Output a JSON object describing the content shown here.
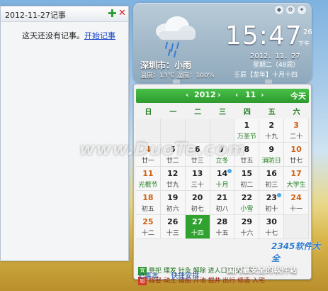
{
  "notes": {
    "date_title": "2012-11-27记事",
    "add_icon": "plus-icon",
    "close_icon": "close-icon",
    "empty_text": "这天还没有记事。",
    "start_link": "开始记事"
  },
  "weather": {
    "city": "深圳市：小雨",
    "detail": "温度：13℃  湿度：100%",
    "icon": "rain-cloud-icon"
  },
  "clock": {
    "time": "15:47",
    "seconds": "26",
    "ampm": "下午",
    "date": "2012．11．27",
    "weekday": "星期二（48周）",
    "lunar": "壬辰【龙年】十月十四"
  },
  "calendar": {
    "year": "2012",
    "month": "11",
    "today_label": "今天",
    "prev": "‹",
    "next": "›",
    "weekdays": [
      "日",
      "一",
      "二",
      "三",
      "四",
      "五",
      "六"
    ],
    "rows": [
      [
        {
          "n": "",
          "l": ""
        },
        {
          "n": "",
          "l": ""
        },
        {
          "n": "",
          "l": ""
        },
        {
          "n": "",
          "l": ""
        },
        {
          "n": "1",
          "l": "万圣节"
        },
        {
          "n": "2",
          "l": "十九"
        },
        {
          "n": "3",
          "l": "二十"
        }
      ],
      [
        {
          "n": "4",
          "l": "廿一"
        },
        {
          "n": "5",
          "l": "廿二"
        },
        {
          "n": "6",
          "l": "廿三"
        },
        {
          "n": "7",
          "l": "立冬"
        },
        {
          "n": "8",
          "l": "廿五"
        },
        {
          "n": "9",
          "l": "消防日"
        },
        {
          "n": "10",
          "l": "廿七"
        }
      ],
      [
        {
          "n": "11",
          "l": "光棍节"
        },
        {
          "n": "12",
          "l": "廿九"
        },
        {
          "n": "13",
          "l": "三十"
        },
        {
          "n": "14",
          "l": "十月"
        },
        {
          "n": "15",
          "l": "初二"
        },
        {
          "n": "16",
          "l": "初三"
        },
        {
          "n": "17",
          "l": "大学生"
        }
      ],
      [
        {
          "n": "18",
          "l": "初五"
        },
        {
          "n": "19",
          "l": "初六"
        },
        {
          "n": "20",
          "l": "初七"
        },
        {
          "n": "21",
          "l": "初八"
        },
        {
          "n": "22",
          "l": "小雪"
        },
        {
          "n": "23",
          "l": "初十"
        },
        {
          "n": "24",
          "l": "十一"
        }
      ],
      [
        {
          "n": "25",
          "l": "十二"
        },
        {
          "n": "26",
          "l": "十三"
        },
        {
          "n": "27",
          "l": "十四"
        },
        {
          "n": "28",
          "l": "十五"
        },
        {
          "n": "29",
          "l": "十六"
        },
        {
          "n": "30",
          "l": "十七"
        },
        {
          "n": "",
          "l": ""
        }
      ]
    ],
    "yi_tag": "宜",
    "yi_text": "祭祀 理发 针灸 解除 进人口 整手足甲",
    "ji_tag": "忌",
    "ji_text": "嫁娶 动土 造船 开池 掘井 出行 修造 入宅"
  },
  "links": {
    "notes": "记事本",
    "schedule": "快捷安排"
  },
  "footer": "国内最安全的软件站",
  "watermark": "www.DuoTe.com",
  "logo": "2345软件大全"
}
